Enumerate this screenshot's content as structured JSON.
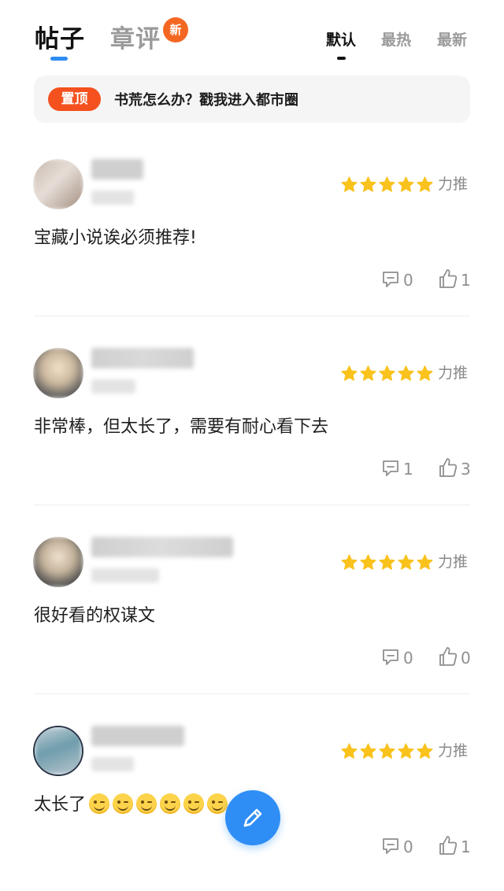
{
  "header": {
    "tab_posts": "帖子",
    "tab_chapter_reviews": "章评",
    "new_badge": "新",
    "sort_options": [
      "默认",
      "最热",
      "最新"
    ]
  },
  "pinned": {
    "tag": "置顶",
    "text": "书荒怎么办？戳我进入都市圈"
  },
  "comments": [
    {
      "text": "宝藏小说诶必须推荐!",
      "rating_label": "力推",
      "stars": 5,
      "replies": "0",
      "likes": "1"
    },
    {
      "text": "非常棒，但太长了，需要有耐心看下去",
      "rating_label": "力推",
      "stars": 5,
      "replies": "1",
      "likes": "3"
    },
    {
      "text": "很好看的权谋文",
      "rating_label": "力推",
      "stars": 5,
      "replies": "0",
      "likes": "0"
    },
    {
      "text": "太长了",
      "rating_label": "力推",
      "stars": 5,
      "replies": "0",
      "likes": "1",
      "emoji_count": 6
    }
  ],
  "colors": {
    "accent": "#2f8cf2",
    "badge": "#f46722",
    "pin_tag": "#f4511e",
    "star": "#f9c21c"
  },
  "icons": {
    "star": "star-icon",
    "reply": "comment-bubble-icon",
    "like": "thumbs-up-icon",
    "compose": "pencil-icon"
  }
}
